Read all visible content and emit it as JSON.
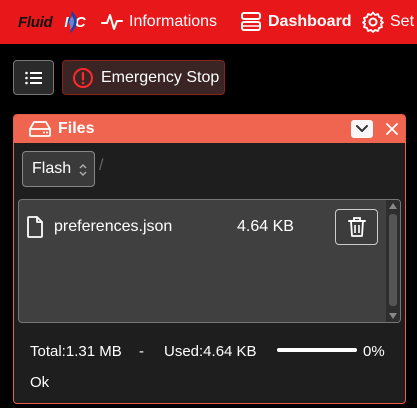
{
  "app": {
    "logo_text": "Fluid",
    "logo_suffix": "NC"
  },
  "nav": {
    "items": [
      {
        "label": "Informations",
        "icon": "pulse-icon"
      },
      {
        "label": "Dashboard",
        "icon": "dashboard-icon"
      },
      {
        "label": "Settings",
        "icon": "gear-icon"
      }
    ],
    "settings_visible_label": "Set"
  },
  "toolbar": {
    "menu_icon": "list-icon",
    "emergency_label": "Emergency Stop"
  },
  "files_panel": {
    "title": "Files",
    "filesystem": "Flash",
    "path_separator": "/",
    "files": [
      {
        "name": "preferences.json",
        "size": "4.64 KB"
      }
    ],
    "total": "Total:1.31 MB",
    "separator": "-",
    "used": "Used:4.64 KB",
    "used_percent_label": "0%",
    "used_fraction": 0.0035,
    "status": "Ok"
  },
  "colors": {
    "nav_bg": "#e8171a",
    "panel_header": "#f06550",
    "estop_border": "#8a2020"
  }
}
